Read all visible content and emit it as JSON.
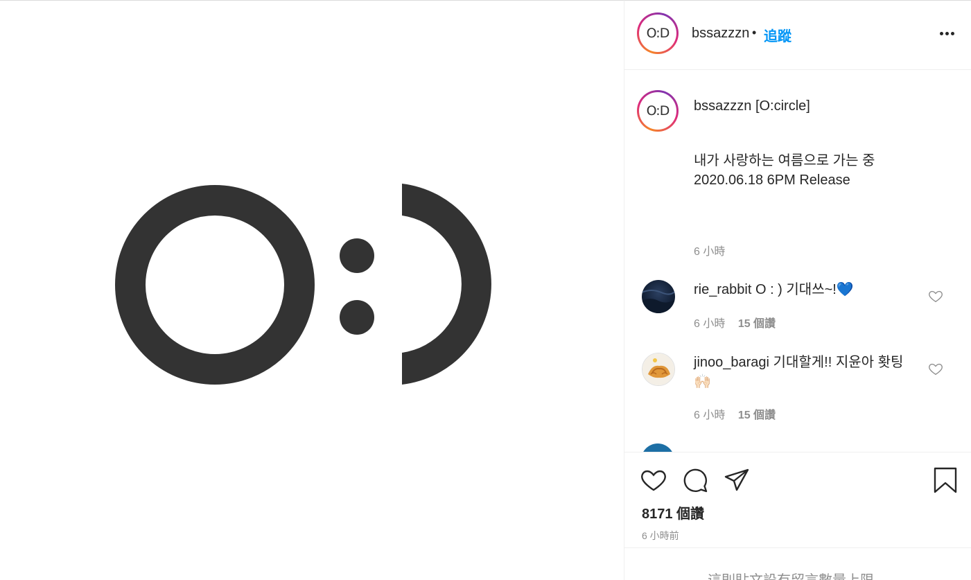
{
  "post": {
    "username": "bssazzzn",
    "separator": "•",
    "follow_label": "追蹤",
    "avatar_text": "O:D",
    "image_text": "O:)"
  },
  "caption": {
    "username": "bssazzzn",
    "title": "[O:circle]",
    "body": "내가 사랑하는 여름으로 가는 중\n2020.06.18 6PM Release",
    "time": "6 小時"
  },
  "comments": [
    {
      "username": "rie_rabbit",
      "text": "O : ) 기대쓰~!💙",
      "time": "6 小時",
      "likes": "15 個讚"
    },
    {
      "username": "jinoo_baragi",
      "text": "기대할게!! 지윤아 홧팅 🙌🏻",
      "time": "6 小時",
      "likes": "15 個讚"
    }
  ],
  "actions": {
    "likes_count": "8171 個讚",
    "posted_time": "6 小時前"
  },
  "footer": {
    "note": "這則貼文設有留言數量上限。"
  },
  "colors": {
    "follow": "#0095f6",
    "muted": "#8e8e8e",
    "text": "#262626",
    "logo": "#333333"
  }
}
